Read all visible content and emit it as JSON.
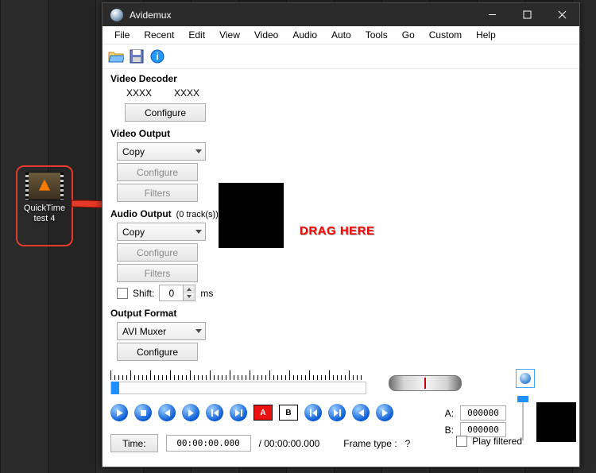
{
  "desktop_file": {
    "label": "QuickTime test 4"
  },
  "window": {
    "title": "Avidemux"
  },
  "menu": {
    "items": [
      "File",
      "Recent",
      "Edit",
      "View",
      "Video",
      "Audio",
      "Auto",
      "Tools",
      "Go",
      "Custom",
      "Help"
    ]
  },
  "video_decoder": {
    "title": "Video Decoder",
    "col1": "XXXX",
    "col2": "XXXX",
    "configure": "Configure"
  },
  "video_output": {
    "title": "Video Output",
    "mode": "Copy",
    "configure": "Configure",
    "filters": "Filters"
  },
  "audio_output": {
    "title": "Audio Output",
    "tracks": "(0 track(s))",
    "mode": "Copy",
    "configure": "Configure",
    "filters": "Filters",
    "shift_label": "Shift:",
    "shift_value": "0",
    "shift_unit": "ms"
  },
  "output_format": {
    "title": "Output Format",
    "mode": "AVI Muxer",
    "configure": "Configure"
  },
  "annotation": {
    "drag": "DRAG HERE"
  },
  "bottom": {
    "time_label": "Time:",
    "time_value": "00:00:00.000",
    "time_total": "/ 00:00:00.000",
    "frame_type_label": "Frame type :",
    "frame_type_value": "?"
  },
  "ab": {
    "a_label": "A:",
    "a_value": "000000",
    "b_label": "B:",
    "b_value": "000000"
  },
  "play_filtered": "Play filtered"
}
